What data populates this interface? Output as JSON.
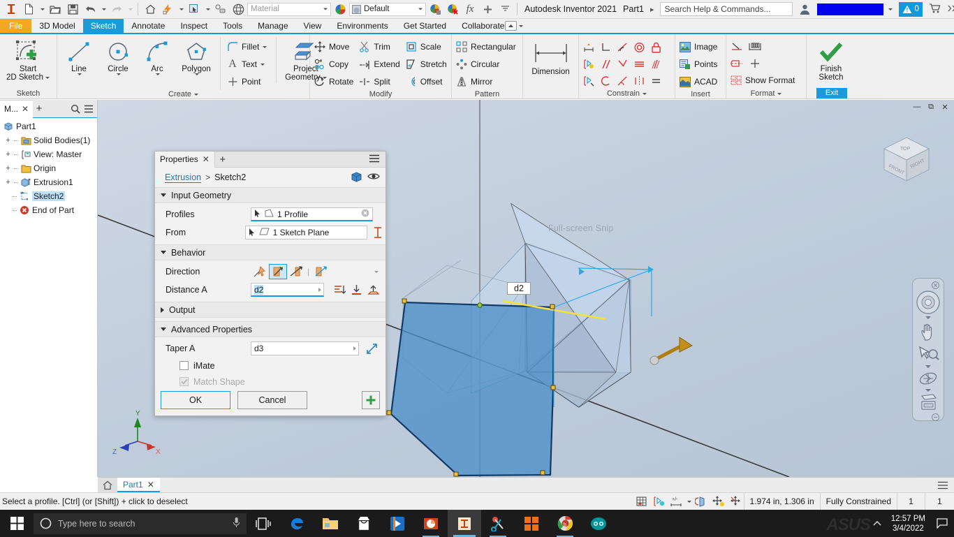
{
  "titlebar": {
    "app_name": "Autodesk Inventor 2021",
    "doc_name": "Part1",
    "search_placeholder": "Search Help & Commands...",
    "notification_count": "0",
    "material_value": "Material",
    "appearance_value": "Default",
    "icons": {
      "logo": "inventor-logo-icon",
      "new": "new-document-icon",
      "open": "open-folder-icon",
      "save": "save-icon",
      "undo": "undo-icon",
      "redo": "redo-icon",
      "home": "home-icon",
      "update": "update-lightning-icon",
      "select": "select-icon",
      "return": "return-icon",
      "appearance_sphere": "appearance-sphere-icon",
      "material_swatch": "material-color-wheel-icon",
      "adjust": "adjust-appearance-icon",
      "clear": "clear-appearance-icon",
      "fx": "parameters-fx-icon",
      "plus": "add-icon",
      "customize": "customize-qat-icon",
      "account": "user-account-icon",
      "alert": "alert-triangle-icon",
      "cart": "shopping-cart-icon",
      "more": "more-chevrons-icon",
      "minimize": "minimize-icon",
      "restore": "restore-icon",
      "close": "close-icon"
    }
  },
  "ribbon_tabs": [
    {
      "label": "File",
      "state": "file"
    },
    {
      "label": "3D Model",
      "state": "normal"
    },
    {
      "label": "Sketch",
      "state": "active"
    },
    {
      "label": "Annotate",
      "state": "normal"
    },
    {
      "label": "Inspect",
      "state": "normal"
    },
    {
      "label": "Tools",
      "state": "normal"
    },
    {
      "label": "Manage",
      "state": "normal"
    },
    {
      "label": "View",
      "state": "normal"
    },
    {
      "label": "Environments",
      "state": "normal"
    },
    {
      "label": "Get Started",
      "state": "normal"
    },
    {
      "label": "Collaborate",
      "state": "normal"
    }
  ],
  "ribbon": {
    "sketch_panel": {
      "title": "Sketch",
      "start_2d_sketch_line1": "Start",
      "start_2d_sketch_line2": "2D Sketch"
    },
    "create_panel": {
      "title": "Create",
      "big": [
        {
          "label": "Line",
          "icon": "line-icon"
        },
        {
          "label": "Circle",
          "icon": "circle-icon"
        },
        {
          "label": "Arc",
          "icon": "arc-icon"
        },
        {
          "label": "Polygon",
          "icon": "polygon-icon"
        }
      ],
      "small": [
        {
          "label": "Fillet",
          "icon": "fillet-icon",
          "dropdown": true
        },
        {
          "label": "Text",
          "icon": "text-icon",
          "dropdown": true
        },
        {
          "label": "Point",
          "icon": "point-icon",
          "dropdown": false
        }
      ],
      "project_geometry_line1": "Project",
      "project_geometry_line2": "Geometry"
    },
    "modify_panel": {
      "title": "Modify",
      "items": [
        {
          "label": "Move",
          "icon": "move-icon"
        },
        {
          "label": "Trim",
          "icon": "trim-scissors-icon"
        },
        {
          "label": "Scale",
          "icon": "scale-icon"
        },
        {
          "label": "Copy",
          "icon": "copy-icon"
        },
        {
          "label": "Extend",
          "icon": "extend-icon"
        },
        {
          "label": "Stretch",
          "icon": "stretch-icon"
        },
        {
          "label": "Rotate",
          "icon": "rotate-icon"
        },
        {
          "label": "Split",
          "icon": "split-icon"
        },
        {
          "label": "Offset",
          "icon": "offset-icon"
        }
      ]
    },
    "pattern_panel": {
      "title": "Pattern",
      "items": [
        {
          "label": "Rectangular",
          "icon": "rectangular-pattern-icon"
        },
        {
          "label": "Circular",
          "icon": "circular-pattern-icon"
        },
        {
          "label": "Mirror",
          "icon": "mirror-icon"
        }
      ]
    },
    "dimension_panel": {
      "label": "Dimension",
      "icon": "dimension-icon"
    },
    "constrain_panel": {
      "title": "Constrain",
      "icons": [
        "coincident-constraint-icon",
        "perpendicular-constraint-icon",
        "tangent-constraint-icon",
        "concentric-constraint-icon",
        "fix-constraint-icon",
        "show-constraints-icon",
        "parallel-constraint-icon",
        "collinear-constraint-icon",
        "horizontal-constraint-icon",
        "vertical-constraint-icon",
        "constraint-settings-icon",
        "equal-radius-icon",
        "smooth-constraint-icon",
        "symmetric-constraint-icon",
        "equal-constraint-icon"
      ]
    },
    "insert_panel": {
      "title": "Insert",
      "items": [
        {
          "label": "Image",
          "icon": "insert-image-icon"
        },
        {
          "label": "Points",
          "icon": "insert-points-icon"
        },
        {
          "label": "ACAD",
          "icon": "insert-acad-icon"
        }
      ]
    },
    "format_panel": {
      "title": "Format",
      "items": [
        {
          "label": "",
          "icon": "construction-line-icon"
        },
        {
          "label": "",
          "icon": "driven-dimension-icon"
        },
        {
          "label": "",
          "icon": "centerline-icon"
        },
        {
          "label": "",
          "icon": "center-point-icon"
        },
        {
          "label": "Show Format",
          "icon": "show-format-icon"
        }
      ]
    },
    "exit_panel": {
      "finish_line1": "Finish",
      "finish_line2": "Sketch",
      "exit_label": "Exit",
      "icon": "finish-sketch-check-icon"
    }
  },
  "browser": {
    "tab_label": "M...",
    "tree": [
      {
        "label": "Part1",
        "indent": 0,
        "expander": "",
        "icon": "part-cube-icon",
        "selected": false
      },
      {
        "label": "Solid Bodies(1)",
        "indent": 1,
        "expander": "+",
        "icon": "folder-solid-icon",
        "selected": false
      },
      {
        "label": "View: Master",
        "indent": 1,
        "expander": "+",
        "icon": "view-master-icon",
        "selected": false
      },
      {
        "label": "Origin",
        "indent": 1,
        "expander": "+",
        "icon": "folder-origin-icon",
        "selected": false
      },
      {
        "label": "Extrusion1",
        "indent": 1,
        "expander": "+",
        "icon": "extrusion-icon",
        "selected": false
      },
      {
        "label": "Sketch2",
        "indent": 2,
        "expander": "",
        "icon": "sketch-icon",
        "selected": true
      },
      {
        "label": "End of Part",
        "indent": 1,
        "expander": "",
        "icon": "end-of-part-icon",
        "selected": false
      }
    ]
  },
  "properties_dialog": {
    "tab_title": "Properties",
    "breadcrumb_link": "Extrusion",
    "breadcrumb_sep": ">",
    "breadcrumb_current": "Sketch2",
    "sections": {
      "input_geometry": {
        "title": "Input Geometry",
        "collapsed": false,
        "profiles_label": "Profiles",
        "profiles_value": "1 Profile",
        "from_label": "From",
        "from_value": "1 Sketch Plane"
      },
      "behavior": {
        "title": "Behavior",
        "collapsed": false,
        "direction_label": "Direction",
        "direction_options": [
          "direction-default-icon",
          "direction-flipped-icon",
          "direction-symmetric-icon",
          "direction-asymmetric-icon"
        ],
        "direction_selected_index": 1,
        "distance_a_label": "Distance A",
        "distance_a_value": "d2"
      },
      "output": {
        "title": "Output",
        "collapsed": true
      },
      "advanced_properties": {
        "title": "Advanced Properties",
        "collapsed": false,
        "taper_a_label": "Taper A",
        "taper_a_value": "d3",
        "imate_label": "iMate",
        "imate_checked": false,
        "match_shape_label": "Match Shape",
        "match_shape_checked": true,
        "match_shape_disabled": true
      }
    },
    "ok_label": "OK",
    "cancel_label": "Cancel",
    "plus_label": "+"
  },
  "viewport": {
    "dimension_label": "d2",
    "watermark": "Full-screen Snip",
    "viewcube_faces": {
      "top": "TOP",
      "front": "FRONT",
      "right": "RIGHT"
    },
    "axis_labels": {
      "x": "X",
      "y": "Y",
      "z": "Z"
    },
    "navbar_icons": [
      "full-navigation-wheel-icon",
      "pan-hand-icon",
      "zoom-magnifier-icon",
      "orbit-icon",
      "look-at-icon"
    ],
    "window_buttons": [
      "minimize-icon",
      "restore-icon",
      "close-icon"
    ]
  },
  "doc_tabs": {
    "home_icon": "home-icon",
    "tabs": [
      {
        "label": "Part1",
        "active": true
      }
    ],
    "menu_icon": "document-list-icon"
  },
  "statusbar": {
    "message": "Select a profile. [Ctrl] (or [Shift]) + click to deselect",
    "icons": [
      "grid-snap-icon",
      "constraint-visibility-icon",
      "dimension-visibility-icon",
      "slice-graphics-icon",
      "show-all-degrees-icon",
      "show-all-constraints-icon"
    ],
    "coordinates": "1.974 in, 1.306 in",
    "constraint_status": "Fully Constrained",
    "count_1": "1",
    "count_2": "1"
  },
  "taskbar": {
    "search_placeholder": "Type here to search",
    "time": "12:57 PM",
    "date": "3/4/2022",
    "brand": "ASUS",
    "apps": [
      {
        "name": "task-view-icon",
        "state": "idle"
      },
      {
        "name": "edge-browser-icon",
        "state": "idle"
      },
      {
        "name": "file-explorer-icon",
        "state": "idle"
      },
      {
        "name": "microsoft-store-icon",
        "state": "idle"
      },
      {
        "name": "media-player-icon",
        "state": "idle"
      },
      {
        "name": "powerpoint-icon",
        "state": "open"
      },
      {
        "name": "inventor-icon",
        "state": "active"
      },
      {
        "name": "snipping-tool-icon",
        "state": "open"
      },
      {
        "name": "office-icon",
        "state": "idle"
      },
      {
        "name": "chrome-icon",
        "state": "open"
      },
      {
        "name": "arduino-icon",
        "state": "idle"
      }
    ]
  }
}
